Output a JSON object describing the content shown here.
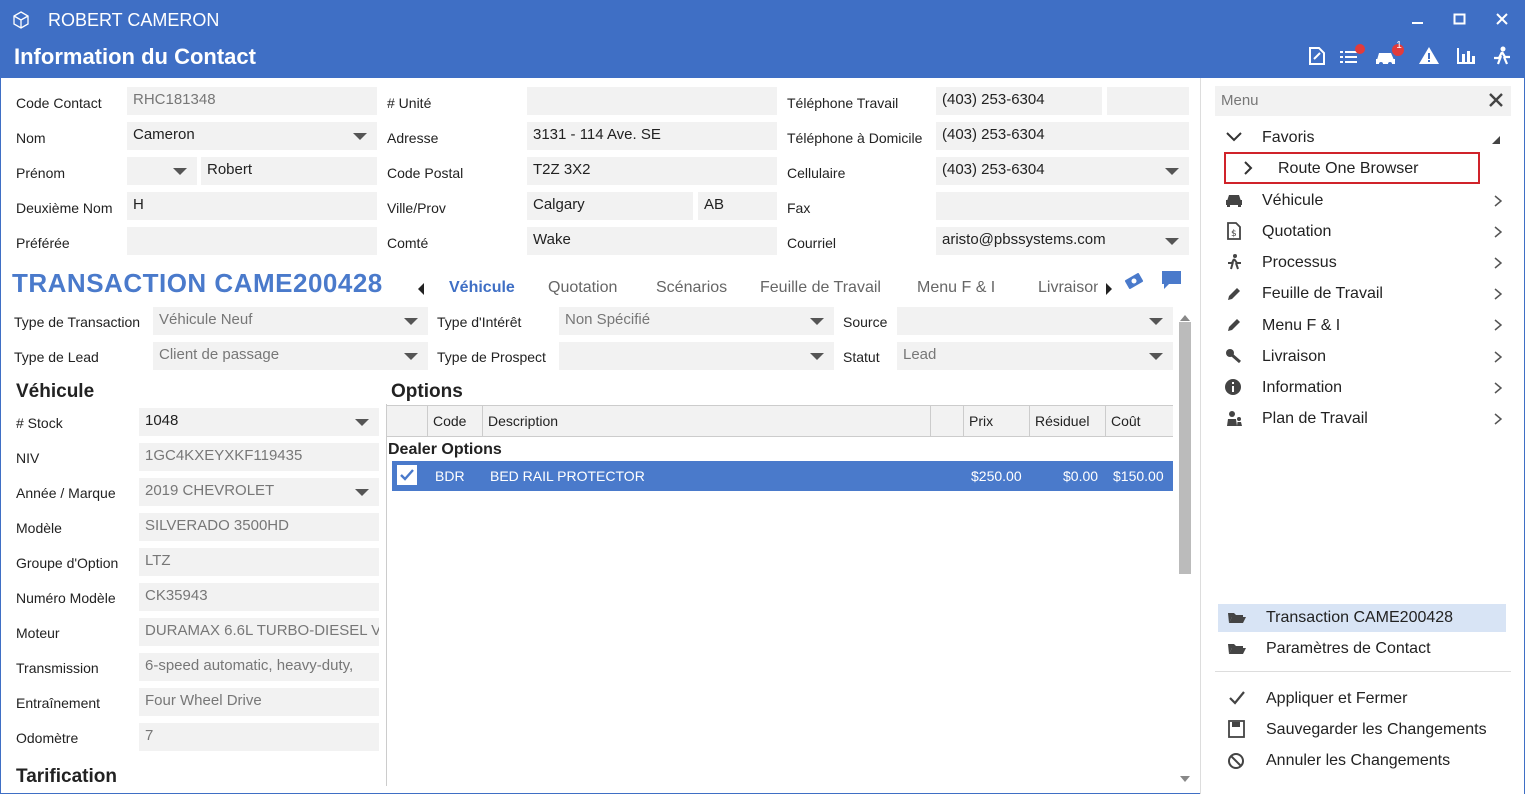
{
  "window": {
    "customer_name": "ROBERT CAMERON",
    "page_title": "Information du Contact",
    "badge_count": "1"
  },
  "contact": {
    "code_label": "Code Contact",
    "code_value": "RHC181348",
    "nom_label": "Nom",
    "nom_value": "Cameron",
    "prenom_label": "Prénom",
    "prenom_value": "Robert",
    "deuxieme_label": "Deuxième Nom",
    "deuxieme_value": "H",
    "preferee_label": "Préférée",
    "preferee_value": "",
    "unite_label": "# Unité",
    "unite_value": "",
    "adresse_label": "Adresse",
    "adresse_value": "3131 - 114 Ave. SE",
    "code_postal_label": "Code Postal",
    "code_postal_value": "T2Z 3X2",
    "ville_label": "Ville/Prov",
    "ville_value": "Calgary",
    "prov_value": "AB",
    "comte_label": "Comté",
    "comte_value": "Wake",
    "tel_travail_label": "Téléphone Travail",
    "tel_travail_value": "(403) 253-6304",
    "tel_travail_ext": "",
    "tel_domicile_label": "Téléphone à Domicile",
    "tel_domicile_value": "(403) 253-6304",
    "cellulaire_label": "Cellulaire",
    "cellulaire_value": "(403) 253-6304",
    "fax_label": "Fax",
    "fax_value": "",
    "courriel_label": "Courriel",
    "courriel_value": "aristo@pbssystems.com"
  },
  "transaction": {
    "title": "TRANSACTION CAME200428",
    "tabs": [
      "Véhicule",
      "Quotation",
      "Scénarios",
      "Feuille de Travail",
      "Menu F & I",
      "Livraison"
    ],
    "active_tab": "Véhicule",
    "type_transaction_label": "Type de Transaction",
    "type_transaction_value": "Véhicule Neuf",
    "type_lead_label": "Type de Lead",
    "type_lead_value": "Client de passage",
    "type_interet_label": "Type d'Intérêt",
    "type_interet_value": "Non Spécifié",
    "type_prospect_label": "Type de Prospect",
    "type_prospect_value": "",
    "source_label": "Source",
    "source_value": "",
    "statut_label": "Statut",
    "statut_value": "Lead"
  },
  "vehicle": {
    "section_title": "Véhicule",
    "fields": [
      {
        "label": "# Stock",
        "value": "1048"
      },
      {
        "label": "NIV",
        "value": "1GC4KXEYXKF119435"
      },
      {
        "label": "Année / Marque",
        "value": "2019 CHEVROLET"
      },
      {
        "label": "Modèle",
        "value": "SILVERADO 3500HD"
      },
      {
        "label": "Groupe d'Option",
        "value": "LTZ"
      },
      {
        "label": "Numéro Modèle",
        "value": "CK35943"
      },
      {
        "label": "Moteur",
        "value": "DURAMAX 6.6L TURBO-DIESEL V"
      },
      {
        "label": "Transmission",
        "value": "6-speed automatic, heavy-duty,"
      },
      {
        "label": "Entraînement",
        "value": "Four Wheel Drive"
      },
      {
        "label": "Odomètre",
        "value": "7"
      }
    ],
    "tarification_title": "Tarification"
  },
  "options": {
    "section_title": "Options",
    "columns": {
      "code": "Code",
      "description": "Description",
      "prix": "Prix",
      "residuel": "Résiduel",
      "cout": "Coût"
    },
    "group_label": "Dealer Options",
    "rows": [
      {
        "code": "BDR",
        "description": "BED RAIL PROTECTOR",
        "prix": "$250.00",
        "residuel": "$0.00",
        "cout": "$150.00",
        "checked": true
      }
    ]
  },
  "sidebar": {
    "search_placeholder": "Menu",
    "favoris_label": "Favoris",
    "favorite_item": "Route One Browser",
    "items": [
      "Véhicule",
      "Quotation",
      "Processus",
      "Feuille de Travail",
      "Menu F & I",
      "Livraison",
      "Information",
      "Plan de Travail"
    ],
    "nav_items": [
      "Transaction CAME200428",
      "Paramètres de Contact"
    ],
    "actions": [
      "Appliquer et Fermer",
      "Sauvegarder les Changements",
      "Annuler les Changements"
    ]
  },
  "colors": {
    "brand": "#3f6fc5",
    "accent": "#4a7acb",
    "highlight": "#d0232a"
  }
}
